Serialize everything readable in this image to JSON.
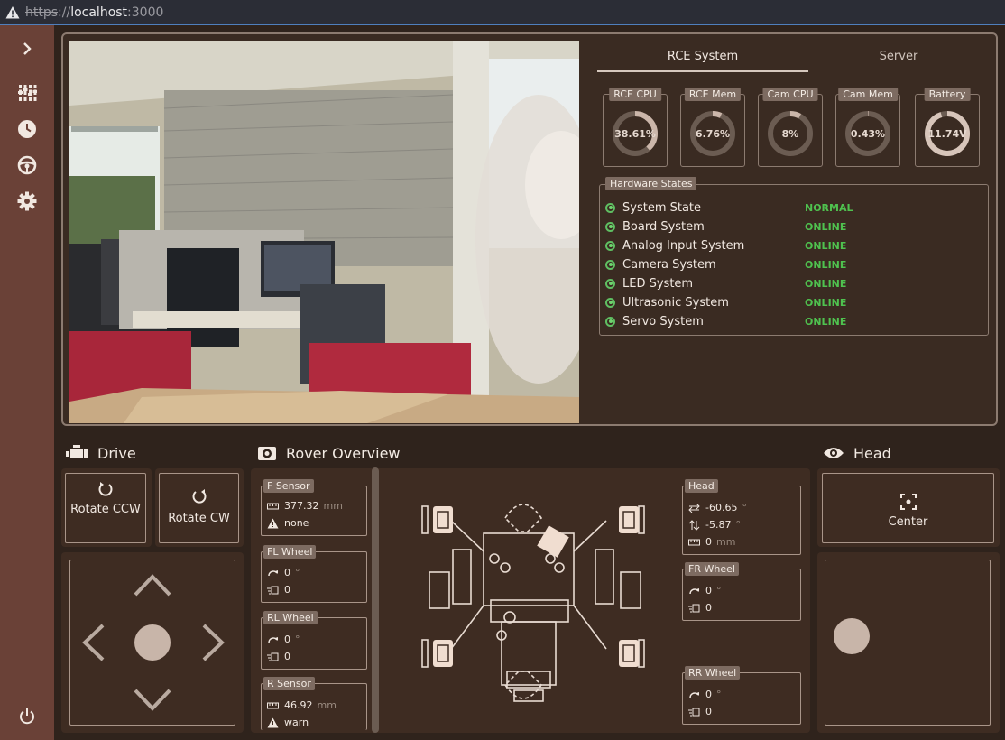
{
  "browser": {
    "scheme": "https",
    "sep": "://",
    "host": "localhost",
    "port": ":3000"
  },
  "sidebar": {
    "icons": [
      "chevron-right-icon",
      "sliders-icon",
      "clock-icon",
      "steering-wheel-icon",
      "gear-icon",
      "power-icon"
    ]
  },
  "tabs": [
    {
      "label": "RCE System",
      "active": true
    },
    {
      "label": "Server",
      "active": false
    }
  ],
  "gauges": [
    {
      "label": "RCE CPU",
      "value": "38.61%",
      "fraction": 0.3861
    },
    {
      "label": "RCE Mem",
      "value": "6.76%",
      "fraction": 0.0676
    },
    {
      "label": "Cam CPU",
      "value": "8%",
      "fraction": 0.08
    },
    {
      "label": "Cam Mem",
      "value": "0.43%",
      "fraction": 0.0043
    },
    {
      "label": "Battery",
      "value": "11.74V",
      "fraction": 0.95
    }
  ],
  "hardware": {
    "title": "Hardware States",
    "rows": [
      {
        "name": "System State",
        "status": "NORMAL"
      },
      {
        "name": "Board System",
        "status": "ONLINE"
      },
      {
        "name": "Analog Input System",
        "status": "ONLINE"
      },
      {
        "name": "Camera System",
        "status": "ONLINE"
      },
      {
        "name": "LED System",
        "status": "ONLINE"
      },
      {
        "name": "Ultrasonic System",
        "status": "ONLINE"
      },
      {
        "name": "Servo System",
        "status": "ONLINE"
      }
    ]
  },
  "drive": {
    "title": "Drive",
    "rotate_ccw": "Rotate CCW",
    "rotate_cw": "Rotate CW"
  },
  "overview": {
    "title": "Rover Overview",
    "f_sensor": {
      "label": "F Sensor",
      "distance": "377.32",
      "unit": "mm",
      "warning": "none"
    },
    "fl_wheel": {
      "label": "FL Wheel",
      "angle": "0",
      "angle_unit": "°",
      "speed": "0"
    },
    "rl_wheel": {
      "label": "RL Wheel",
      "angle": "0",
      "angle_unit": "°",
      "speed": "0"
    },
    "r_sensor": {
      "label": "R Sensor",
      "distance": "46.92",
      "unit": "mm",
      "warning": "warn"
    },
    "head": {
      "label": "Head",
      "pan": "-60.65",
      "tilt": "-5.87",
      "deg": "°",
      "distance": "0",
      "unit": "mm"
    },
    "fr_wheel": {
      "label": "FR Wheel",
      "angle": "0",
      "angle_unit": "°",
      "speed": "0"
    },
    "rr_wheel": {
      "label": "RR Wheel",
      "angle": "0",
      "angle_unit": "°",
      "speed": "0"
    }
  },
  "head_panel": {
    "title": "Head",
    "center_label": "Center"
  },
  "colors": {
    "accent": "#d9c4b8",
    "online": "#4fc24f",
    "sidebar": "#6a4137",
    "background": "#2f231c"
  }
}
